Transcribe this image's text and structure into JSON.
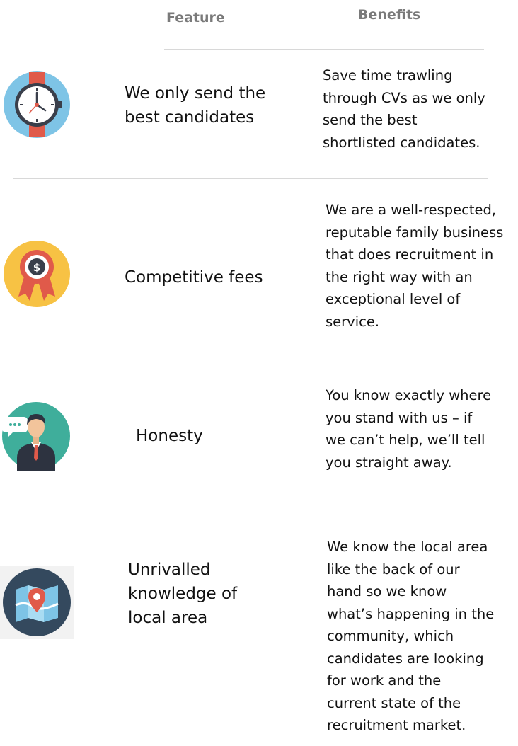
{
  "header": {
    "feature_label": "Feature",
    "benefits_label": "Benefits"
  },
  "rows": [
    {
      "icon": "watch-icon",
      "feature": "We only send the\nbest candidates",
      "benefit": "Save time trawling\nthrough CVs as we only\nsend the best\nshortlisted candidates."
    },
    {
      "icon": "award-medal-icon",
      "feature": "Competitive fees",
      "benefit": "We are a well-respected,\nreputable family business\nthat does recruitment in\nthe right way with an\nexceptional level of\nservice."
    },
    {
      "icon": "businessman-speech-icon",
      "feature": "Honesty",
      "benefit": "You know exactly where\nyou stand with us – if\nwe can’t help, we’ll tell\nyou straight away."
    },
    {
      "icon": "map-pin-icon",
      "feature": "Unrivalled\nknowledge of\nlocal area",
      "benefit": "We know the local area\nlike the back of our\nhand so we know\nwhat’s happening in the\ncommunity, which\ncandidates are looking\nfor work and the\ncurrent state of the\nrecruitment market."
    }
  ],
  "colors": {
    "header_text": "#7a7a7a",
    "divider": "#d8d8d8",
    "body_text": "#111111"
  }
}
